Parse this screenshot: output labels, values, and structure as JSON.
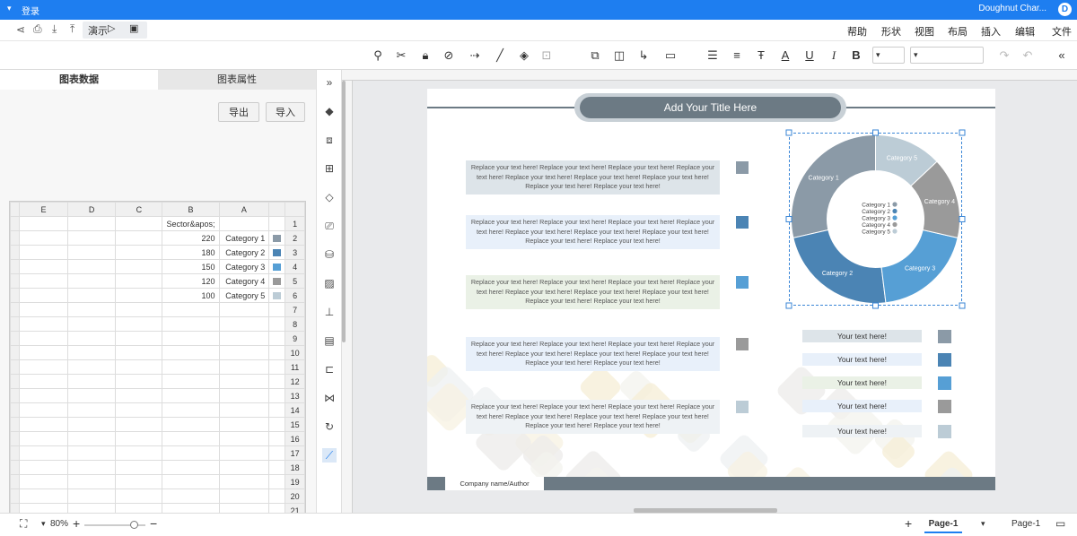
{
  "app": {
    "title": "Doughnut Char...",
    "login_label": "登录"
  },
  "menu": [
    "文件",
    "编辑",
    "插入",
    "布局",
    "视图",
    "形状",
    "帮助"
  ],
  "quickbar": {
    "present_label": "演示"
  },
  "panel": {
    "tabs": [
      "图表数据",
      "图表属性"
    ],
    "import_label": "导入",
    "export_label": "导出",
    "columns": [
      "A",
      "B",
      "C",
      "D",
      "E"
    ],
    "rows": [
      {
        "n": "1",
        "color": "",
        "a": "",
        "b": "Sector&apos;"
      },
      {
        "n": "2",
        "color": "#8b9aa7",
        "a": "Category 1",
        "b": "220"
      },
      {
        "n": "3",
        "color": "#4b84b4",
        "a": "Category 2",
        "b": "180"
      },
      {
        "n": "4",
        "color": "#569fd5",
        "a": "Category 3",
        "b": "150"
      },
      {
        "n": "5",
        "color": "#9a9a9a",
        "a": "Category 4",
        "b": "120"
      },
      {
        "n": "6",
        "color": "#bcccd6",
        "a": "Category 5",
        "b": "100"
      },
      {
        "n": "7"
      },
      {
        "n": "8"
      },
      {
        "n": "9"
      },
      {
        "n": "10"
      },
      {
        "n": "11"
      },
      {
        "n": "12"
      },
      {
        "n": "13"
      },
      {
        "n": "14"
      },
      {
        "n": "15"
      },
      {
        "n": "16"
      },
      {
        "n": "17"
      },
      {
        "n": "18"
      },
      {
        "n": "19"
      },
      {
        "n": "20"
      },
      {
        "n": "21"
      }
    ]
  },
  "slide": {
    "title": "Add Your Title Here",
    "body_text": "Replace your text here! Replace your text here! Replace your text here! Replace your text here! Replace your text here! Replace your text here! Replace your text here! Replace your text here! Replace your text here!",
    "text_boxes": [
      {
        "bg": "#dde4e9",
        "sq": "#8b9aa7"
      },
      {
        "bg": "#e8f0fa",
        "sq": "#4b84b4"
      },
      {
        "bg": "#eaf1e6",
        "sq": "#569fd5"
      },
      {
        "bg": "#e8f0fa",
        "sq": "#9a9a9a"
      },
      {
        "bg": "#eef2f5",
        "sq": "#bcccd6"
      }
    ],
    "legend_boxes": [
      {
        "label": "Your text here!",
        "bg": "#dde4e9",
        "sq": "#8b9aa7"
      },
      {
        "label": "Your text here!",
        "bg": "#e8f0fa",
        "sq": "#4b84b4"
      },
      {
        "label": "Your text here!",
        "bg": "#eaf1e6",
        "sq": "#569fd5"
      },
      {
        "label": "Your text here!",
        "bg": "#e8f0fa",
        "sq": "#9a9a9a"
      },
      {
        "label": "Your text here!",
        "bg": "#eef2f5",
        "sq": "#bcccd6"
      }
    ],
    "footer": "Company name/Author"
  },
  "chart_data": {
    "type": "doughnut",
    "categories": [
      "Category 1",
      "Category 2",
      "Category 3",
      "Category 4",
      "Category 5"
    ],
    "values": [
      220,
      180,
      150,
      120,
      100
    ],
    "colors": [
      "#8b9aa7",
      "#4b84b4",
      "#569fd5",
      "#9a9a9a",
      "#bcccd6"
    ]
  },
  "status": {
    "page_select": "Page-1",
    "page_tab": "Page-1",
    "zoom": "80%"
  }
}
